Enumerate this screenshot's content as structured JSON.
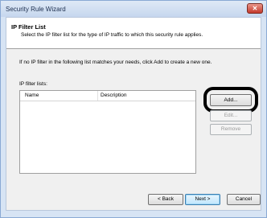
{
  "window": {
    "title": "Security Rule Wizard",
    "close_glyph": "✕"
  },
  "header": {
    "title": "IP Filter List",
    "subtitle": "Select the IP filter list for the type of IP traffic to which this security rule applies."
  },
  "body": {
    "info_text": "If no IP filter in the following list matches your needs, click Add to create a new one.",
    "list_label": "IP filter lists:"
  },
  "filter_list": {
    "columns": [
      "Name",
      "Description"
    ],
    "rows": []
  },
  "side_buttons": {
    "add": "Add...",
    "edit": "Edit...",
    "remove": "Remove"
  },
  "footer": {
    "back": "< Back",
    "next": "Next >",
    "cancel": "Cancel"
  }
}
